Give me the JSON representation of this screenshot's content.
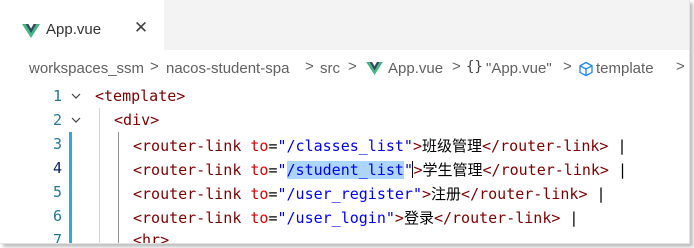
{
  "colors": {
    "vue_green": "#41b883",
    "vue_dark": "#35495e",
    "tag": "#800000",
    "attr": "#e50000",
    "string": "#0000ff",
    "line_number": "#237893",
    "selection": "#add6ff"
  },
  "tab": {
    "icon": "vue-file-icon",
    "label": "App.vue",
    "close_glyph": "✕"
  },
  "breadcrumb": {
    "items": [
      "workspaces_ssm",
      "nacos-student-spa",
      "src",
      "App.vue",
      "\"App.vue\"",
      "template"
    ],
    "separator": ">",
    "braces_glyph": "{}",
    "overflow_glyph": ">"
  },
  "editor": {
    "lines": [
      {
        "number": "1",
        "open": "<",
        "tag": "template",
        "close": ">"
      },
      {
        "number": "2",
        "open": "<",
        "tag": "div",
        "close": ">"
      },
      {
        "number": "3",
        "open": "<",
        "tag": "router-link",
        "attr": "to",
        "eq": "=",
        "value": "\"/classes_list\"",
        "close": ">",
        "text": "班级管理",
        "end_tag": "</router-link>",
        "pipe": " |"
      },
      {
        "number": "4",
        "open": "<",
        "tag": "router-link",
        "attr": "to",
        "eq": "=",
        "value_before": "\"",
        "value_selected": "/student_list",
        "value_after": "\"",
        "close": ">",
        "text": "学生管理",
        "end_tag": "</router-link>",
        "pipe": " |"
      },
      {
        "number": "5",
        "open": "<",
        "tag": "router-link",
        "attr": "to",
        "eq": "=",
        "value": "\"/user_register\"",
        "close": ">",
        "text": "注册",
        "end_tag": "</router-link>",
        "pipe": " |"
      },
      {
        "number": "6",
        "open": "<",
        "tag": "router-link",
        "attr": "to",
        "eq": "=",
        "value": "\"/user_login\"",
        "close": ">",
        "text": "登录",
        "end_tag": "</router-link>",
        "pipe": " |"
      },
      {
        "number": "7",
        "open": "<",
        "tag": "hr",
        "close": ">"
      }
    ]
  }
}
